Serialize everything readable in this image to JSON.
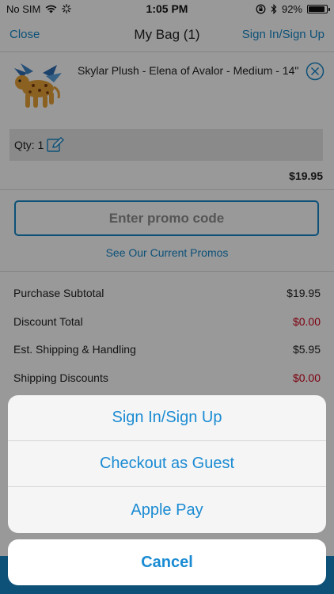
{
  "status_bar": {
    "carrier": "No SIM",
    "time": "1:05 PM",
    "battery": "92%",
    "battery_level": 0.92
  },
  "nav": {
    "close_label": "Close",
    "title": "My Bag (1)",
    "sign_in_label": "Sign In/Sign Up"
  },
  "product": {
    "name": "Skylar Plush - Elena of Avalor - Medium - 14\"",
    "qty_label": "Qty: 1",
    "price": "$19.95"
  },
  "promo": {
    "placeholder": "Enter promo code",
    "see_promos_label": "See Our Current Promos"
  },
  "summary": {
    "rows": [
      {
        "label": "Purchase Subtotal",
        "value": "$19.95"
      },
      {
        "label": "Discount Total",
        "value": "$0.00"
      },
      {
        "label": "Est. Shipping & Handling",
        "value": "$5.95"
      },
      {
        "label": "Shipping Discounts",
        "value": "$0.00"
      }
    ]
  },
  "action_sheet": {
    "options": [
      "Sign In/Sign Up",
      "Checkout as Guest",
      "Apple Pay"
    ],
    "cancel_label": "Cancel"
  },
  "colors": {
    "accent": "#1787c9",
    "negative": "#d0021b"
  }
}
